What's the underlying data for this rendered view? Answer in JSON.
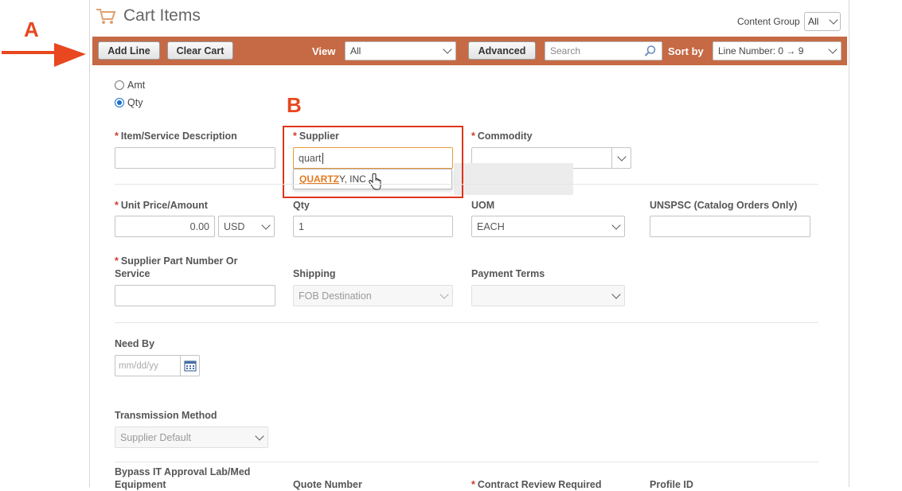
{
  "header": {
    "title": "Cart Items",
    "content_group_label": "Content Group",
    "content_group_value": "All"
  },
  "annotations": {
    "a": "A",
    "b": "B"
  },
  "toolbar": {
    "add_line": "Add Line",
    "clear_cart": "Clear Cart",
    "view_label": "View",
    "view_value": "All",
    "advanced": "Advanced",
    "search_placeholder": "Search",
    "sort_label": "Sort by",
    "sort_value": "Line Number: 0 → 9",
    "bg_color": "#c56a45"
  },
  "form": {
    "radio_amt": "Amt",
    "radio_qty": "Qty",
    "item_desc_label": "Item/Service Description",
    "supplier_label": "Supplier",
    "supplier_value": "quart",
    "supplier_suggestion_match": "QUARTZ",
    "supplier_suggestion_rest": "Y, INC",
    "commodity_label": "Commodity",
    "unit_price_label": "Unit Price/Amount",
    "unit_price_value": "0.00",
    "currency": "USD",
    "qty_label": "Qty",
    "qty_value": "1",
    "uom_label": "UOM",
    "uom_value": "EACH",
    "unspsc_label": "UNSPSC (Catalog Orders Only)",
    "supplier_part_label_1": "Supplier Part Number Or",
    "supplier_part_label_2": "Service",
    "shipping_label": "Shipping",
    "shipping_value": "FOB Destination",
    "payment_terms_label": "Payment Terms",
    "need_by_label": "Need By",
    "need_by_placeholder": "mm/dd/yy",
    "transmission_label": "Transmission Method",
    "transmission_value": "Supplier Default",
    "bypass_label_1": "Bypass IT Approval Lab/Med",
    "bypass_label_2": "Equipment",
    "quote_number_label": "Quote Number",
    "contract_review_label": "Contract Review Required",
    "profile_id_label": "Profile ID"
  },
  "colors": {
    "required": "#d03a2a",
    "annotation": "#e8471f",
    "match": "#e47a1f"
  }
}
